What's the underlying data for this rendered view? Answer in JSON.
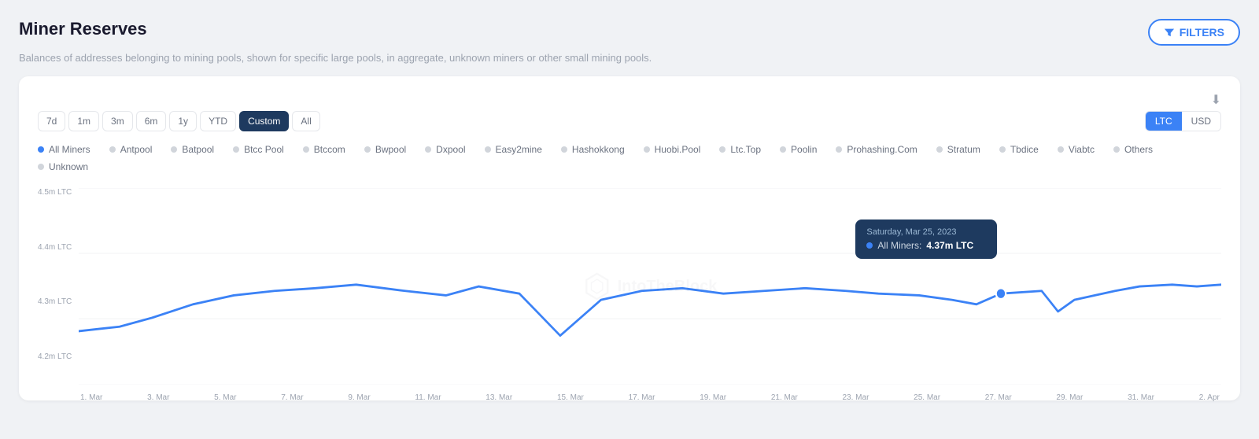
{
  "page": {
    "title": "Miner Reserves",
    "subtitle": "Balances of addresses belonging to mining pools, shown for specific large pools, in aggregate, unknown miners or other small mining pools.",
    "filters_label": "FILTERS",
    "download_label": "⬇"
  },
  "time_buttons": [
    {
      "label": "7d",
      "id": "7d",
      "active": false
    },
    {
      "label": "1m",
      "id": "1m",
      "active": false
    },
    {
      "label": "3m",
      "id": "3m",
      "active": false
    },
    {
      "label": "6m",
      "id": "6m",
      "active": false
    },
    {
      "label": "1y",
      "id": "1y",
      "active": false
    },
    {
      "label": "YTD",
      "id": "ytd",
      "active": false
    },
    {
      "label": "Custom",
      "id": "custom",
      "active": true
    },
    {
      "label": "All",
      "id": "all",
      "active": false
    }
  ],
  "currency_buttons": [
    {
      "label": "LTC",
      "active": true
    },
    {
      "label": "USD",
      "active": false
    }
  ],
  "legend": [
    {
      "label": "All Miners",
      "color": "blue"
    },
    {
      "label": "Antpool",
      "color": "gray"
    },
    {
      "label": "Batpool",
      "color": "gray"
    },
    {
      "label": "Btcc Pool",
      "color": "gray"
    },
    {
      "label": "Btccom",
      "color": "gray"
    },
    {
      "label": "Bwpool",
      "color": "gray"
    },
    {
      "label": "Dxpool",
      "color": "gray"
    },
    {
      "label": "Easy2mine",
      "color": "gray"
    },
    {
      "label": "Hashokkong",
      "color": "gray"
    },
    {
      "label": "Huobi.Pool",
      "color": "gray"
    },
    {
      "label": "Ltc.Top",
      "color": "gray"
    },
    {
      "label": "Poolin",
      "color": "gray"
    },
    {
      "label": "Prohashing.Com",
      "color": "gray"
    },
    {
      "label": "Stratum",
      "color": "gray"
    },
    {
      "label": "Tbdice",
      "color": "gray"
    },
    {
      "label": "Viabtc",
      "color": "gray"
    },
    {
      "label": "Others",
      "color": "gray"
    },
    {
      "label": "Unknown",
      "color": "gray"
    }
  ],
  "y_axis": [
    "4.5m LTC",
    "4.4m LTC",
    "4.3m LTC",
    "4.2m LTC"
  ],
  "x_axis": [
    "1. Mar",
    "3. Mar",
    "5. Mar",
    "7. Mar",
    "9. Mar",
    "11. Mar",
    "13. Mar",
    "15. Mar",
    "17. Mar",
    "19. Mar",
    "21. Mar",
    "23. Mar",
    "25. Mar",
    "27. Mar",
    "29. Mar",
    "31. Mar",
    "2. Apr"
  ],
  "tooltip": {
    "date": "Saturday, Mar 25, 2023",
    "label": "All Miners:",
    "value": "4.37m LTC"
  },
  "watermark": "⬡ IntoTheBlock"
}
